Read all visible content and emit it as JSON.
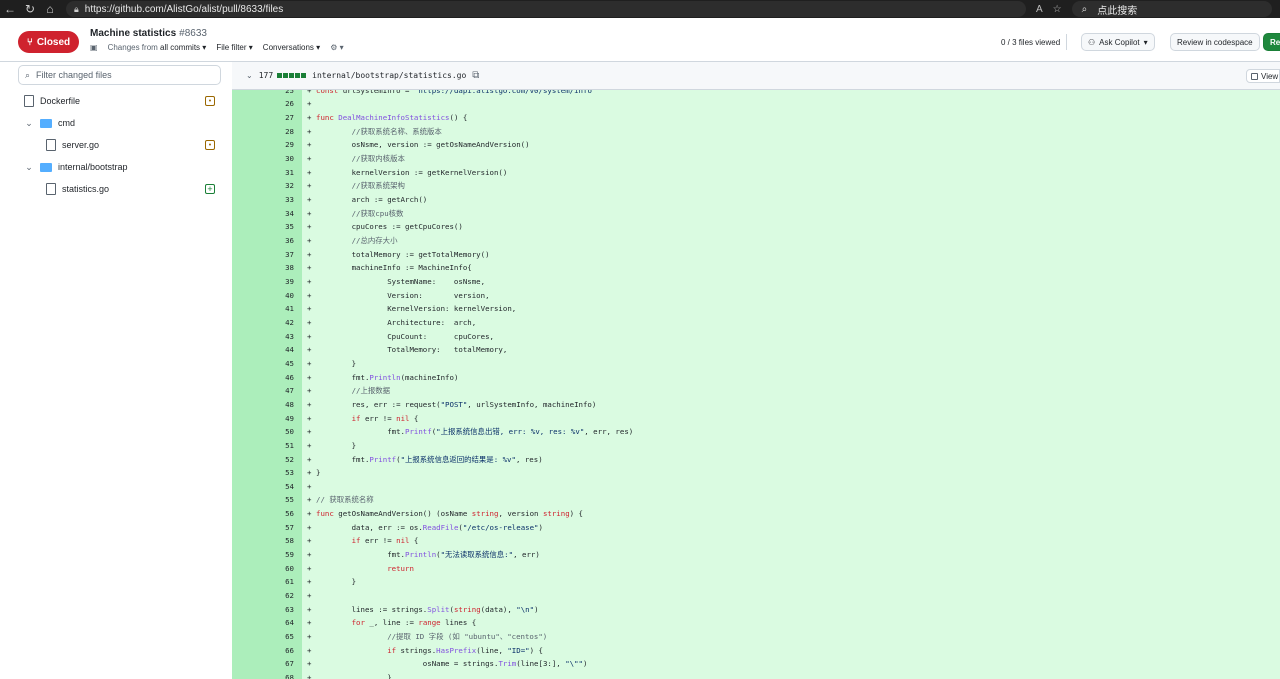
{
  "browser": {
    "url": "https://github.com/AlistGo/alist/pull/8633/files",
    "search_placeholder": "点此搜索"
  },
  "pr": {
    "state": "Closed",
    "title": "Machine statistics",
    "number": "#8633",
    "changes_from": "Changes from",
    "all_commits": "all commits",
    "file_filter": "File filter",
    "conversations": "Conversations",
    "files_viewed": "0 / 3 files viewed",
    "ask_copilot": "Ask Copilot",
    "review_codespace": "Review in codespace",
    "review_changes": "Rev"
  },
  "sidebar": {
    "filter_placeholder": "Filter changed files",
    "items": [
      {
        "label": "Dockerfile",
        "type": "file",
        "status": "modified"
      },
      {
        "label": "cmd",
        "type": "folder"
      },
      {
        "label": "server.go",
        "type": "file",
        "status": "modified"
      },
      {
        "label": "internal/bootstrap",
        "type": "folder"
      },
      {
        "label": "statistics.go",
        "type": "file",
        "status": "added"
      }
    ]
  },
  "file": {
    "additions": "177",
    "path": "internal/bootstrap/statistics.go",
    "view_label": "View"
  },
  "colors": {
    "closed": "#cf222e",
    "added_bg": "#dafbe1",
    "added_gutter": "#aceebb",
    "keyword": "#cf222e",
    "function": "#8250df",
    "string": "#0a3069"
  },
  "code_lines": [
    {
      "n": "25",
      "t": "const urlSystemInfo = \"https://dapi.alistgo.com/v0/system/info\""
    },
    {
      "n": "26",
      "t": ""
    },
    {
      "n": "27",
      "t": "func DealMachineInfoStatistics() {"
    },
    {
      "n": "28",
      "t": "        //获取系统名称、系统版本"
    },
    {
      "n": "29",
      "t": "        osNsme, version := getOsNameAndVersion()"
    },
    {
      "n": "30",
      "t": "        //获取内核版本"
    },
    {
      "n": "31",
      "t": "        kernelVersion := getKernelVersion()"
    },
    {
      "n": "32",
      "t": "        //获取系统架构"
    },
    {
      "n": "33",
      "t": "        arch := getArch()"
    },
    {
      "n": "34",
      "t": "        //获取cpu核数"
    },
    {
      "n": "35",
      "t": "        cpuCores := getCpuCores()"
    },
    {
      "n": "36",
      "t": "        //总内存大小"
    },
    {
      "n": "37",
      "t": "        totalMemory := getTotalMemory()"
    },
    {
      "n": "38",
      "t": "        machineInfo := MachineInfo{"
    },
    {
      "n": "39",
      "t": "                SystemName:    osNsme,"
    },
    {
      "n": "40",
      "t": "                Version:       version,"
    },
    {
      "n": "41",
      "t": "                KernelVersion: kernelVersion,"
    },
    {
      "n": "42",
      "t": "                Architecture:  arch,"
    },
    {
      "n": "43",
      "t": "                CpuCount:      cpuCores,"
    },
    {
      "n": "44",
      "t": "                TotalMemory:   totalMemory,"
    },
    {
      "n": "45",
      "t": "        }"
    },
    {
      "n": "46",
      "t": "        fmt.Println(machineInfo)"
    },
    {
      "n": "47",
      "t": "        //上报数据"
    },
    {
      "n": "48",
      "t": "        res, err := request(\"POST\", urlSystemInfo, machineInfo)"
    },
    {
      "n": "49",
      "t": "        if err != nil {"
    },
    {
      "n": "50",
      "t": "                fmt.Printf(\"上报系统信息出错, err: %v, res: %v\", err, res)"
    },
    {
      "n": "51",
      "t": "        }"
    },
    {
      "n": "52",
      "t": "        fmt.Printf(\"上报系统信息返回的结果是: %v\", res)"
    },
    {
      "n": "53",
      "t": "}"
    },
    {
      "n": "54",
      "t": ""
    },
    {
      "n": "55",
      "t": "// 获取系统名称"
    },
    {
      "n": "56",
      "t": "func getOsNameAndVersion() (osName string, version string) {"
    },
    {
      "n": "57",
      "t": "        data, err := os.ReadFile(\"/etc/os-release\")"
    },
    {
      "n": "58",
      "t": "        if err != nil {"
    },
    {
      "n": "59",
      "t": "                fmt.Println(\"无法读取系统信息:\", err)"
    },
    {
      "n": "60",
      "t": "                return"
    },
    {
      "n": "61",
      "t": "        }"
    },
    {
      "n": "62",
      "t": ""
    },
    {
      "n": "63",
      "t": "        lines := strings.Split(string(data), \"\\n\")"
    },
    {
      "n": "64",
      "t": "        for _, line := range lines {"
    },
    {
      "n": "65",
      "t": "                //提取 ID 字段 (如 \"ubuntu\"、\"centos\")"
    },
    {
      "n": "66",
      "t": "                if strings.HasPrefix(line, \"ID=\") {"
    },
    {
      "n": "67",
      "t": "                        osName = strings.Trim(line[3:], \"\\\"\")"
    },
    {
      "n": "68",
      "t": "                }"
    }
  ]
}
